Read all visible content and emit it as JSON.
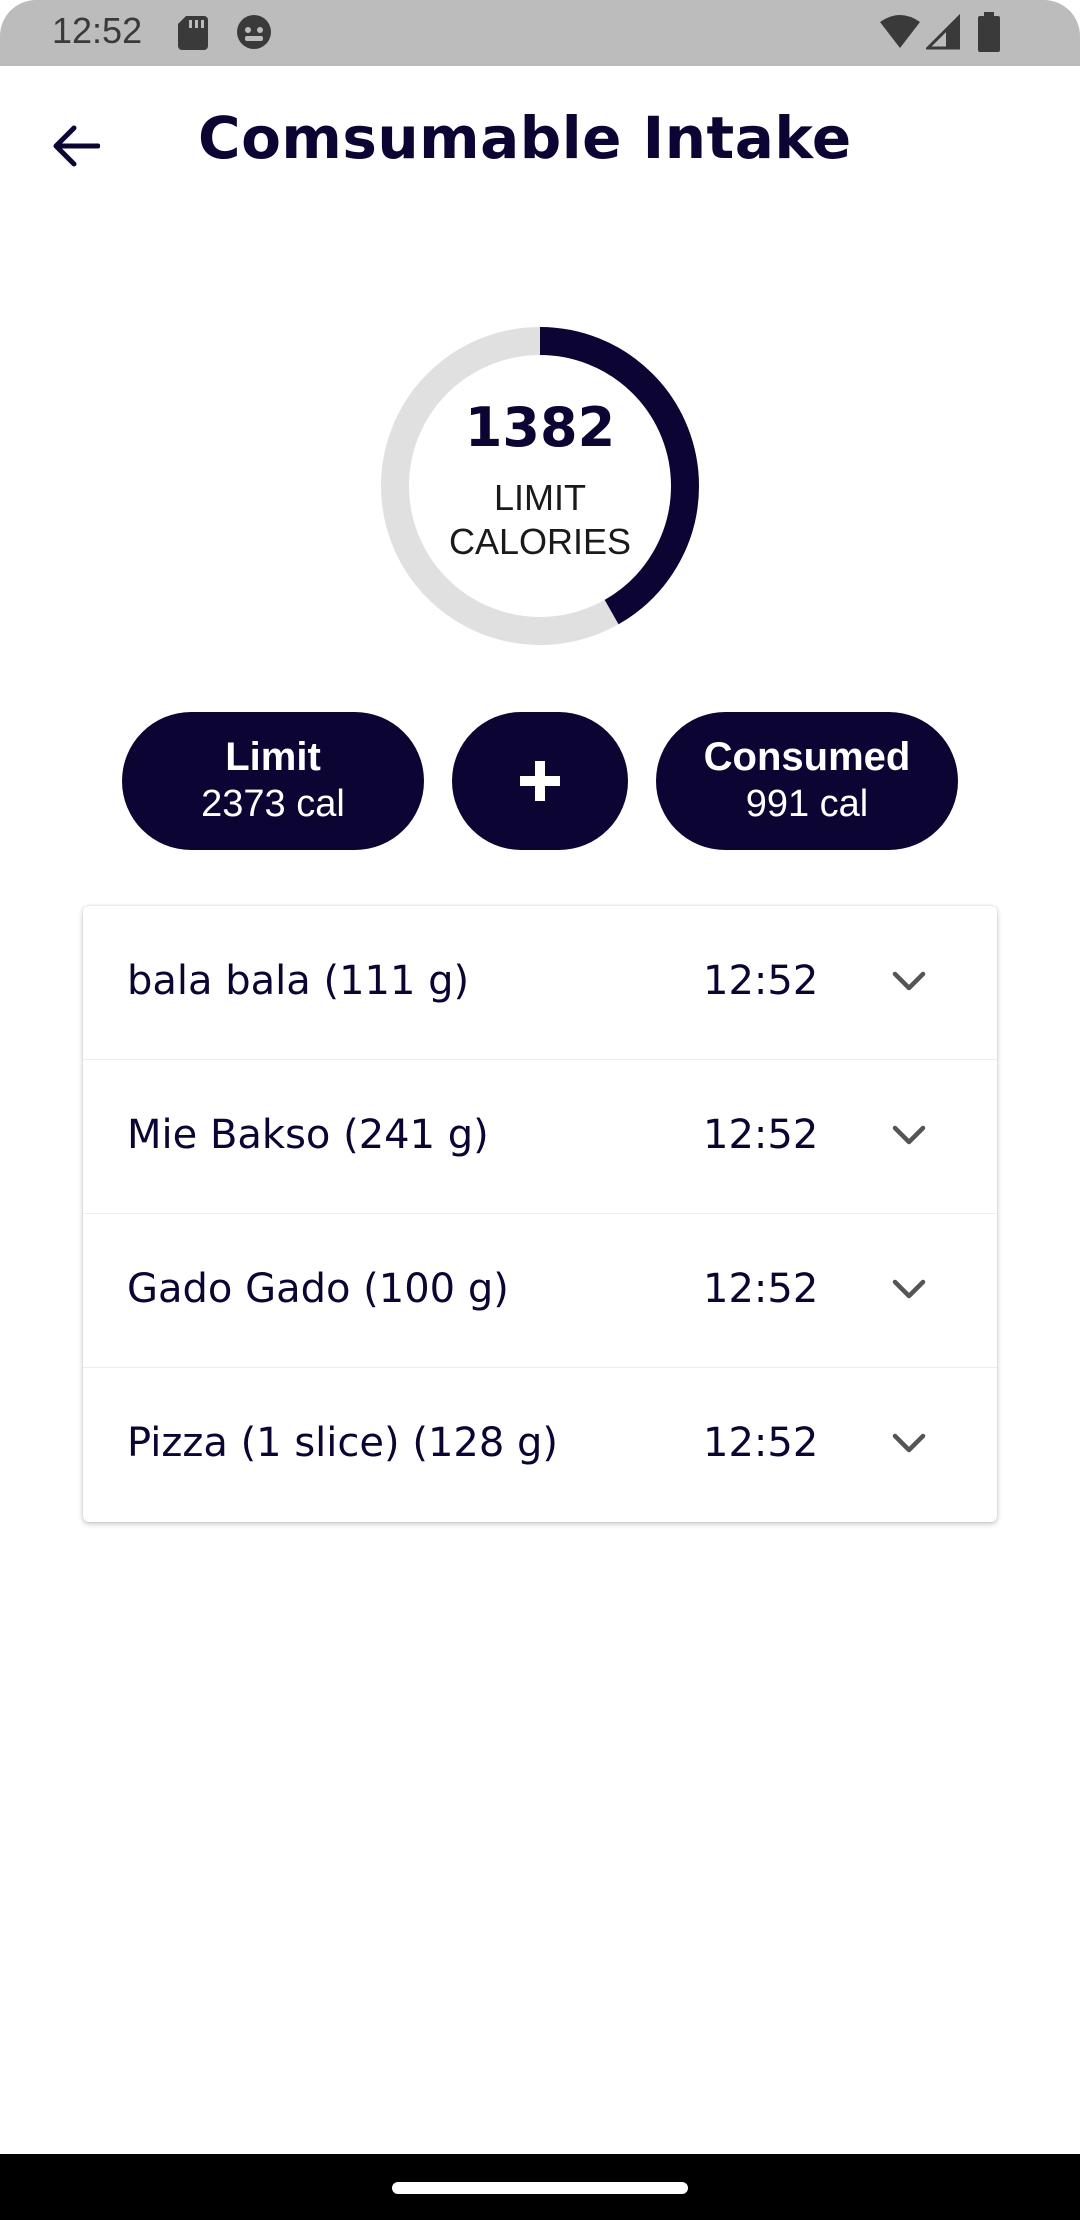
{
  "status_bar": {
    "time": "12:52",
    "icons": [
      "sd-card-icon",
      "android-icon",
      "wifi-icon",
      "signal-icon",
      "battery-icon"
    ]
  },
  "header": {
    "back_icon": "arrow-back-icon",
    "title": "Comsumable Intake"
  },
  "summary": {
    "remaining_value": "1382",
    "remaining_label_line1": "LIMIT",
    "remaining_label_line2": "CALORIES",
    "consumed_fraction": 0.4176,
    "limit_title": "Limit",
    "limit_value": "2373 cal",
    "add_label": "+",
    "consumed_title": "Consumed",
    "consumed_value": "991 cal"
  },
  "intake_items": [
    {
      "name": "bala bala (111 g)",
      "time": "12:52"
    },
    {
      "name": "Mie Bakso (241 g)",
      "time": "12:52"
    },
    {
      "name": "Gado Gado (100 g)",
      "time": "12:52"
    },
    {
      "name": "Pizza (1 slice) (128 g)",
      "time": "12:52"
    }
  ],
  "colors": {
    "primary": "#0c0433",
    "ring_track": "#e0e0e0",
    "status_bar": "#bcbcbc",
    "chevron": "#555555"
  }
}
